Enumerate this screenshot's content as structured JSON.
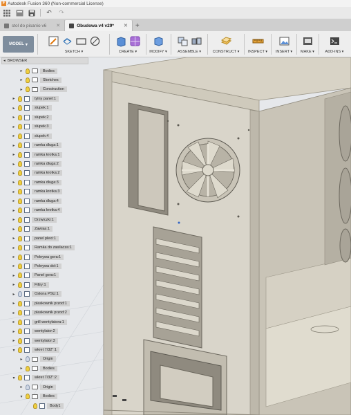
{
  "window": {
    "title": "Autodesk Fusion 360 (Non-commercial License)",
    "logo": "F"
  },
  "tabs": [
    {
      "label": "stol do pisanio v6",
      "active": false
    },
    {
      "label": "Obudowa v4 v29*",
      "active": true
    }
  ],
  "ribbon": {
    "workspace": "MODEL",
    "groups": [
      "SKETCH",
      "CREATE",
      "MODIFY",
      "ASSEMBLE",
      "CONSTRUCT",
      "INSPECT",
      "INSERT",
      "MAKE",
      "ADD-INS"
    ]
  },
  "browser": {
    "title": "BROWSER",
    "items": [
      {
        "label": "Bodies",
        "indent": 2,
        "kind": "folder"
      },
      {
        "label": "Sketches",
        "indent": 2,
        "kind": "folder"
      },
      {
        "label": "Construction",
        "indent": 2,
        "kind": "folder"
      },
      {
        "label": "tylny panel:1",
        "indent": 1,
        "kind": "comp"
      },
      {
        "label": "slupek:1",
        "indent": 1,
        "kind": "comp"
      },
      {
        "label": "slupek:2",
        "indent": 1,
        "kind": "comp"
      },
      {
        "label": "slupek:3",
        "indent": 1,
        "kind": "comp"
      },
      {
        "label": "slupek:4",
        "indent": 1,
        "kind": "comp"
      },
      {
        "label": "ramka dluga:1",
        "indent": 1,
        "kind": "comp"
      },
      {
        "label": "ramka krotka:1",
        "indent": 1,
        "kind": "comp"
      },
      {
        "label": "ramka dluga:2",
        "indent": 1,
        "kind": "comp"
      },
      {
        "label": "ramka krotka:2",
        "indent": 1,
        "kind": "comp"
      },
      {
        "label": "ramka dluga:3",
        "indent": 1,
        "kind": "comp"
      },
      {
        "label": "ramka krotka:3",
        "indent": 1,
        "kind": "comp"
      },
      {
        "label": "ramka dluga:4",
        "indent": 1,
        "kind": "comp"
      },
      {
        "label": "ramka krotka:4",
        "indent": 1,
        "kind": "comp"
      },
      {
        "label": "Drzwiczki:1",
        "indent": 1,
        "kind": "comp"
      },
      {
        "label": "Zawias:1",
        "indent": 1,
        "kind": "comp"
      },
      {
        "label": "panel plexi:1",
        "indent": 1,
        "kind": "comp"
      },
      {
        "label": "Ramka do zasilacza:1",
        "indent": 1,
        "kind": "comp"
      },
      {
        "label": "Pokrywa gora:1",
        "indent": 1,
        "kind": "comp"
      },
      {
        "label": "Pokrywa dol:1",
        "indent": 1,
        "kind": "comp"
      },
      {
        "label": "Panel gora:1",
        "indent": 1,
        "kind": "comp"
      },
      {
        "label": "Filtry:1",
        "indent": 1,
        "kind": "comp"
      },
      {
        "label": "Oslona PSU:1",
        "indent": 1,
        "kind": "comp"
      },
      {
        "label": "plaskownik przod:1",
        "indent": 1,
        "kind": "comp"
      },
      {
        "label": "plaskownik przod:2",
        "indent": 1,
        "kind": "comp"
      },
      {
        "label": "grill wentylatora:1",
        "indent": 1,
        "kind": "comp"
      },
      {
        "label": "wentylator:2",
        "indent": 1,
        "kind": "comp"
      },
      {
        "label": "wentylator:3",
        "indent": 1,
        "kind": "comp"
      },
      {
        "label": "wkret 7/32\":1",
        "indent": 1,
        "kind": "comp",
        "open": true
      },
      {
        "label": "Origin",
        "indent": 2,
        "kind": "folder"
      },
      {
        "label": "Bodies",
        "indent": 2,
        "kind": "folder"
      },
      {
        "label": "wkret 7/32\":2",
        "indent": 1,
        "kind": "comp",
        "open": true
      },
      {
        "label": "Origin",
        "indent": 2,
        "kind": "folder"
      },
      {
        "label": "Bodies",
        "indent": 2,
        "kind": "folder",
        "open": true
      },
      {
        "label": "Body1",
        "indent": 3,
        "kind": "comp"
      }
    ]
  }
}
